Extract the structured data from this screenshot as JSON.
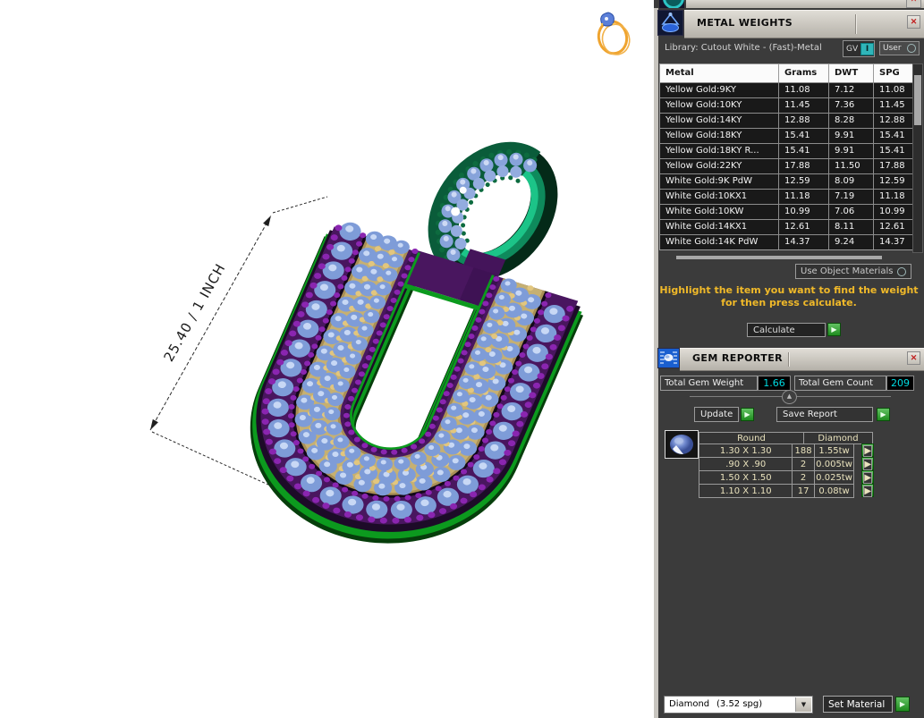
{
  "icons": {
    "close_glyph": "✕",
    "play_glyph": "▶",
    "dropdown_glyph": "▼",
    "collapse_glyph": "▲"
  },
  "viewport": {
    "dimension_label": "25.40 / 1 INCH"
  },
  "metal_weights": {
    "title": "METAL WEIGHTS",
    "library_label": "Library: Cutout White - (Fast)-Metal",
    "gv_label": "GV",
    "gv_state": "I",
    "user_label": "User",
    "columns": [
      "Metal",
      "Grams",
      "DWT",
      "SPG"
    ],
    "rows": [
      {
        "metal": "Yellow Gold:9KY",
        "grams": "11.08",
        "dwt": "7.12",
        "spg": "11.08"
      },
      {
        "metal": "Yellow Gold:10KY",
        "grams": "11.45",
        "dwt": "7.36",
        "spg": "11.45"
      },
      {
        "metal": "Yellow Gold:14KY",
        "grams": "12.88",
        "dwt": "8.28",
        "spg": "12.88"
      },
      {
        "metal": "Yellow Gold:18KY",
        "grams": "15.41",
        "dwt": "9.91",
        "spg": "15.41"
      },
      {
        "metal": "Yellow Gold:18KY R...",
        "grams": "15.41",
        "dwt": "9.91",
        "spg": "15.41"
      },
      {
        "metal": "Yellow Gold:22KY",
        "grams": "17.88",
        "dwt": "11.50",
        "spg": "17.88"
      },
      {
        "metal": "White Gold:9K PdW",
        "grams": "12.59",
        "dwt": "8.09",
        "spg": "12.59"
      },
      {
        "metal": "White Gold:10KX1",
        "grams": "11.18",
        "dwt": "7.19",
        "spg": "11.18"
      },
      {
        "metal": "White Gold:10KW",
        "grams": "10.99",
        "dwt": "7.06",
        "spg": "10.99"
      },
      {
        "metal": "White Gold:14KX1",
        "grams": "12.61",
        "dwt": "8.11",
        "spg": "12.61"
      },
      {
        "metal": "White Gold:14K PdW",
        "grams": "14.37",
        "dwt": "9.24",
        "spg": "14.37"
      }
    ],
    "use_object_materials_label": "Use Object Materials",
    "hint_line1": "Highlight the item you want to find the weight",
    "hint_line2": "for then press calculate.",
    "calculate_label": "Calculate"
  },
  "gem_reporter": {
    "title": "GEM REPORTER",
    "total_weight_label": "Total Gem Weight",
    "total_weight_value": "1.66",
    "total_count_label": "Total Gem Count",
    "total_count_value": "209",
    "update_label": "Update",
    "save_report_label": "Save Report",
    "table": {
      "shape_header": "Round",
      "type_header": "Diamond",
      "rows": [
        {
          "size": "1.30 X 1.30",
          "count": "188",
          "weight": "1.55tw"
        },
        {
          "size": ".90 X .90",
          "count": "2",
          "weight": "0.005tw"
        },
        {
          "size": "1.50 X 1.50",
          "count": "2",
          "weight": "0.025tw"
        },
        {
          "size": "1.10 X 1.10",
          "count": "17",
          "weight": "0.08tw"
        }
      ]
    },
    "material_name": "Diamond",
    "material_spg": "(3.52 spg)",
    "set_material_label": "Set Material"
  },
  "colors": {
    "accent_green": "#2f9e2f",
    "value_cyan": "#00dce2",
    "hint_yellow": "#f0b929",
    "gem_blue": "#7e9cd8",
    "metal_purple": "#49165f",
    "base_green": "#0c9a1e",
    "channel_gold": "#c6b072",
    "bail_teal": "#0b6b46"
  }
}
